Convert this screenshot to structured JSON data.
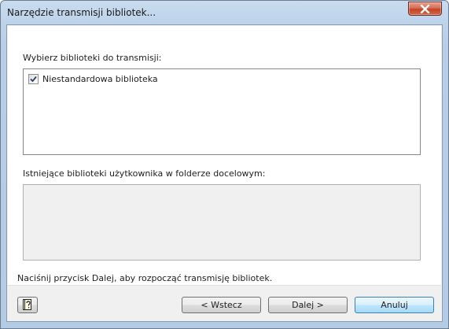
{
  "window": {
    "title": "Narzędzie transmisji bibliotek..."
  },
  "form": {
    "select_label": "Wybierz biblioteki do transmisji:",
    "libraries": [
      {
        "label": "Niestandardowa biblioteka",
        "checked": true
      }
    ],
    "existing_label": "Istniejące biblioteki użytkownika w folderze docelowym:",
    "existing_libraries": [],
    "instruction": "Naciśnij przycisk Dalej, aby rozpocząć transmisję bibliotek."
  },
  "buttons": {
    "help_icon": "help-book-icon",
    "back_label": "< Wstecz",
    "next_label": "Dalej >",
    "cancel_label": "Anuluj"
  },
  "colors": {
    "titlebar": "#bdd3ea",
    "close_button": "#c34326",
    "default_button_border": "#3c7fb1"
  }
}
